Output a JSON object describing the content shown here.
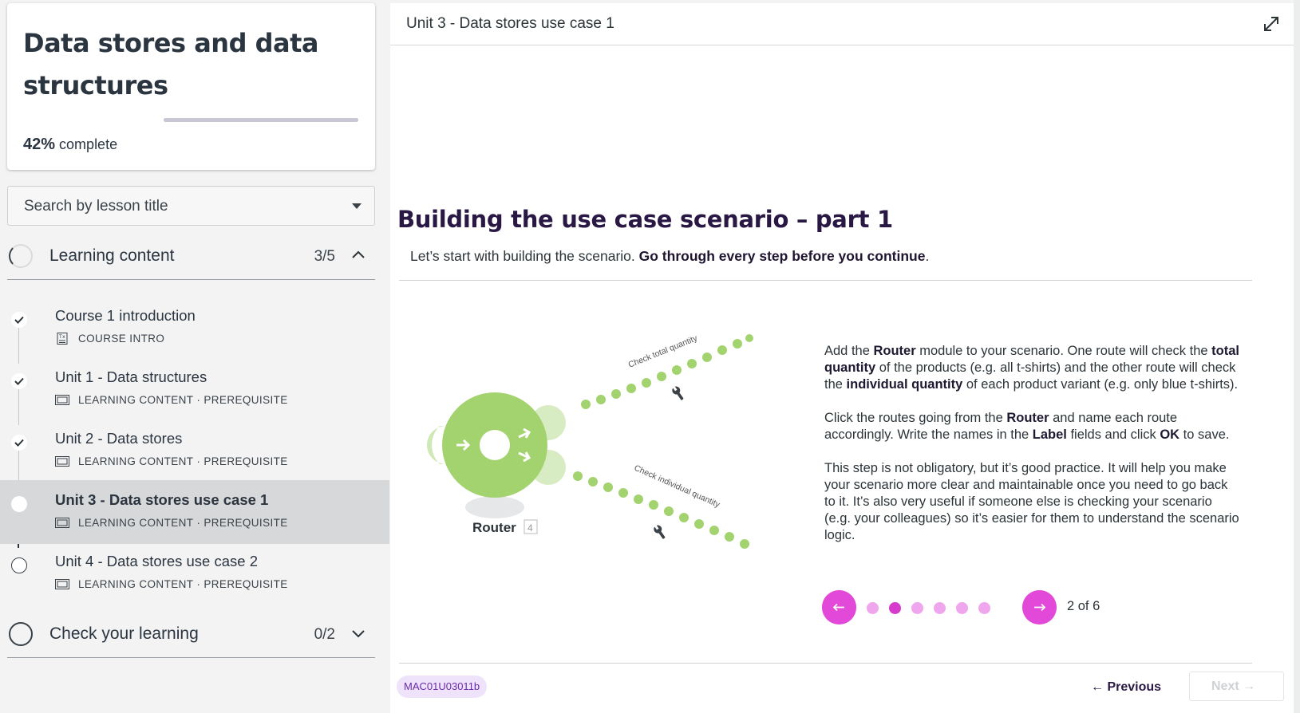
{
  "sidebar": {
    "course_title": "Data stores and data structures",
    "progress_percent_value": 42,
    "progress_percent": "42%",
    "progress_suffix": "complete",
    "search_placeholder": "Search by lesson title",
    "sections": [
      {
        "title": "Learning content",
        "count": "3/5",
        "expanded": true,
        "lessons": [
          {
            "title": "Course 1 introduction",
            "meta": "COURSE INTRO",
            "status": "complete",
            "icon": "document-icon"
          },
          {
            "title": "Unit 1 - Data structures",
            "meta": "LEARNING CONTENT · PREREQUISITE",
            "status": "complete",
            "icon": "slides-icon"
          },
          {
            "title": "Unit 2 - Data stores",
            "meta": "LEARNING CONTENT · PREREQUISITE",
            "status": "complete",
            "icon": "slides-icon"
          },
          {
            "title": "Unit 3 - Data stores use case 1",
            "meta": "LEARNING CONTENT · PREREQUISITE",
            "status": "current",
            "icon": "slides-icon"
          },
          {
            "title": "Unit 4 - Data stores use case 2",
            "meta": "LEARNING CONTENT · PREREQUISITE",
            "status": "not-started",
            "icon": "slides-icon"
          }
        ]
      },
      {
        "title": "Check your learning",
        "count": "0/2",
        "expanded": false
      }
    ]
  },
  "main": {
    "header_title": "Unit 3 - Data stores use case 1",
    "lesson_heading": "Building the use case scenario – part 1",
    "intro_plain": "Let’s start with building the scenario. ",
    "intro_bold": "Go through every step before you continue",
    "intro_end": ".",
    "diagram": {
      "router_label": "Router",
      "router_number": "4",
      "route_top_label": "Check total quantity",
      "route_bottom_label": "Check individual quantity"
    },
    "step": {
      "p1": [
        "Add the ",
        "Router",
        " module to your scenario. One route will check the ",
        "total quantity",
        " of the products (e.g. all t-shirts) and the other route will check the ",
        "individual quantity",
        " of each product variant (e.g. only blue t-shirts)."
      ],
      "p2": [
        "Click the routes going from the ",
        "Router",
        " and name each route accordingly. Write the names in the ",
        "Label",
        " fields and click ",
        "OK",
        " to save."
      ],
      "p3": "This step is not obligatory, but it’s good practice. It will help you make your scenario more clear and maintainable once you need to go back to it. It’s also very useful if someone else is checking your scenario (e.g. your colleagues) so it’s easier for them to understand the scenario logic.",
      "current": 2,
      "total": 6,
      "counter_text": "2 of 6"
    },
    "lesson_code": "MAC01U03011b",
    "previous_label": "← Previous",
    "next_label": "Next →",
    "colors": {
      "accent_magenta": "#e249d9",
      "heading_purple": "#2a1844",
      "router_green": "#a3d36f"
    }
  }
}
